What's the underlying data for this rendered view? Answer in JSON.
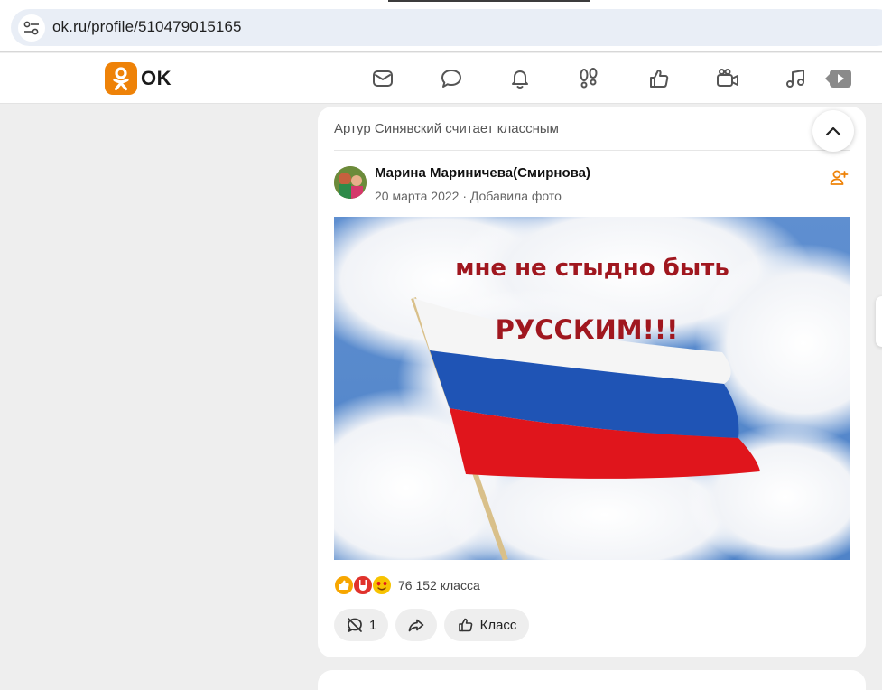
{
  "browser": {
    "url": "ok.ru/profile/510479015165",
    "site_info_icon": "tune-icon"
  },
  "header": {
    "logo_text": "OK",
    "brand_color": "#ee8208",
    "nav_icons": [
      "mail-icon",
      "chat-icon",
      "bell-icon",
      "footprints-icon",
      "thumbs-up-icon",
      "video-camera-icon",
      "music-note-icon",
      "play-icon"
    ]
  },
  "post": {
    "liked_by_text": "Артур Синявский считает классным",
    "author_name": "Марина Мариничева(Смирнова)",
    "date": "20 марта 2022",
    "separator": "·",
    "action_text": "Добавила фото",
    "image_text_line1": "мне не стыдно быть",
    "image_text_line2": "РУССКИМ!!!",
    "likes_count": "76 152 класса",
    "comments_count": "1",
    "klass_label": "Класс"
  }
}
